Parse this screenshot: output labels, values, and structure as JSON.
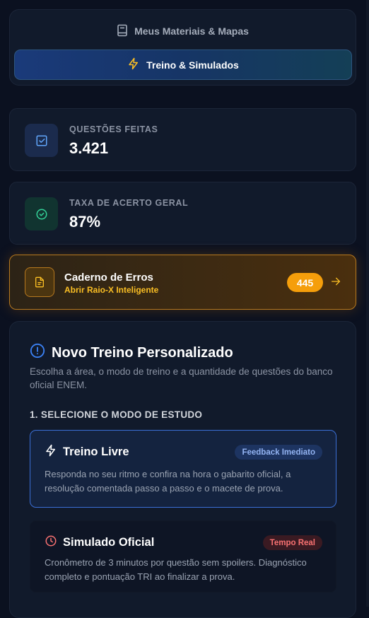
{
  "nav": {
    "materials_label": "Meus Materiais & Mapas",
    "training_label": "Treino & Simulados"
  },
  "stats": [
    {
      "label": "QUESTÕES FEITAS",
      "value": "3.421"
    },
    {
      "label": "TAXA DE ACERTO GERAL",
      "value": "87%"
    }
  ],
  "errors_notebook": {
    "title": "Caderno de Erros",
    "subtitle": "Abrir Raio-X Inteligente",
    "count": "445"
  },
  "training": {
    "title": "Novo Treino Personalizado",
    "description": "Escolha a área, o modo de treino e a quantidade de questões do banco oficial ENEM.",
    "section_label": "1. SELECIONE O MODO DE ESTUDO",
    "modes": [
      {
        "title": "Treino Livre",
        "badge": "Feedback Imediato",
        "description": "Responda no seu ritmo e confira na hora o gabarito oficial, a resolução comentada passo a passo e o macete de prova."
      },
      {
        "title": "Simulado Oficial",
        "badge": "Tempo Real",
        "description": "Cronômetro de 3 minutos por questão sem spoilers. Diagnóstico completo e pontuação TRI ao finalizar a prova."
      }
    ]
  },
  "colors": {
    "background": "#0b1120",
    "card": "#111a2b",
    "accent_blue": "#3b6fd6",
    "accent_amber": "#f59e0b",
    "accent_green": "#34d399",
    "accent_red": "#f87171"
  }
}
